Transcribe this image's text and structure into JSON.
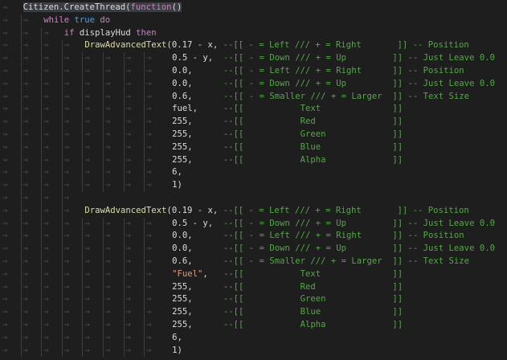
{
  "code": {
    "colors": {
      "background": "#1e1e1e",
      "text": "#dcdcdc",
      "keyword": "#c586c0",
      "boolean": "#569cd6",
      "function": "#dcdcaa",
      "string": "#d69d85",
      "comment": "#57a64a"
    },
    "lines": [
      {
        "indent": 1,
        "highlight": true,
        "tokens": [
          {
            "t": "tx",
            "text": "Citizen.CreateThread("
          },
          {
            "t": "kw",
            "text": "function"
          },
          {
            "t": "tx",
            "text": "()"
          }
        ]
      },
      {
        "indent": 2,
        "tokens": [
          {
            "t": "kw",
            "text": "while"
          },
          {
            "t": "tx",
            "text": " "
          },
          {
            "t": "bool",
            "text": "true"
          },
          {
            "t": "tx",
            "text": " "
          },
          {
            "t": "kw",
            "text": "do"
          }
        ]
      },
      {
        "indent": 3,
        "tokens": [
          {
            "t": "kw",
            "text": "if"
          },
          {
            "t": "tx",
            "text": " displayHud "
          },
          {
            "t": "kw",
            "text": "then"
          }
        ]
      },
      {
        "indent": 4,
        "tokens": [
          {
            "t": "fn",
            "text": "DrawAdvancedText"
          },
          {
            "t": "tx",
            "text": "(0.17 - x, "
          },
          {
            "t": "cm",
            "text": "--[[ - = Left /// + = Right       ]] -- Position"
          }
        ]
      },
      {
        "indent": 8,
        "tokens": [
          {
            "t": "tx",
            "text": " 0.5 - y,  "
          },
          {
            "t": "cm",
            "text": "--[[ - = Down /// + = Up         ]] -- Just Leave 0.0"
          }
        ]
      },
      {
        "indent": 8,
        "tokens": [
          {
            "t": "tx",
            "text": " 0.0,      "
          },
          {
            "t": "cm",
            "text": "--[[ - = Left /// + = Right      ]] -- Position"
          }
        ]
      },
      {
        "indent": 8,
        "tokens": [
          {
            "t": "tx",
            "text": " 0.0,      "
          },
          {
            "t": "cm",
            "text": "--[[ - = Down /// + = Up         ]] -- Just Leave 0.0"
          }
        ]
      },
      {
        "indent": 8,
        "tokens": [
          {
            "t": "tx",
            "text": " 0.6,      "
          },
          {
            "t": "cm",
            "text": "--[[ - = Smaller /// + = Larger  ]] -- Text Size"
          }
        ]
      },
      {
        "indent": 8,
        "tokens": [
          {
            "t": "tx",
            "text": " fuel,     "
          },
          {
            "t": "cm",
            "text": "--[[           Text              ]]"
          }
        ]
      },
      {
        "indent": 8,
        "tokens": [
          {
            "t": "tx",
            "text": " 255,      "
          },
          {
            "t": "cm",
            "text": "--[[           Red               ]]"
          }
        ]
      },
      {
        "indent": 8,
        "tokens": [
          {
            "t": "tx",
            "text": " 255,      "
          },
          {
            "t": "cm",
            "text": "--[[           Green             ]]"
          }
        ]
      },
      {
        "indent": 8,
        "tokens": [
          {
            "t": "tx",
            "text": " 255,      "
          },
          {
            "t": "cm",
            "text": "--[[           Blue              ]]"
          }
        ]
      },
      {
        "indent": 8,
        "tokens": [
          {
            "t": "tx",
            "text": " 255,      "
          },
          {
            "t": "cm",
            "text": "--[[           Alpha             ]]"
          }
        ]
      },
      {
        "indent": 8,
        "tokens": [
          {
            "t": "tx",
            "text": " 6,"
          }
        ]
      },
      {
        "indent": 8,
        "tokens": [
          {
            "t": "tx",
            "text": " 1)"
          }
        ]
      },
      {
        "indent": 4,
        "tokens": []
      },
      {
        "indent": 4,
        "tokens": [
          {
            "t": "fn",
            "text": "DrawAdvancedText"
          },
          {
            "t": "tx",
            "text": "(0.19 - x, "
          },
          {
            "t": "cm",
            "text": "--[[ - = Left /// + = Right       ]] -- Position"
          }
        ]
      },
      {
        "indent": 8,
        "tokens": [
          {
            "t": "tx",
            "text": " 0.5 - y,  "
          },
          {
            "t": "cm",
            "text": "--[[ - = Down /// + = Up         ]] -- Just Leave 0.0"
          }
        ]
      },
      {
        "indent": 8,
        "tokens": [
          {
            "t": "tx",
            "text": " 0.0,      "
          },
          {
            "t": "cm",
            "text": "--[[ - = Left /// + = Right      ]] -- Position"
          }
        ]
      },
      {
        "indent": 8,
        "tokens": [
          {
            "t": "tx",
            "text": " 0.0,      "
          },
          {
            "t": "cm",
            "text": "--[[ - = Down /// + = Up         ]] -- Just Leave 0.0"
          }
        ]
      },
      {
        "indent": 8,
        "tokens": [
          {
            "t": "tx",
            "text": " 0.6,      "
          },
          {
            "t": "cm",
            "text": "--[[ - = Smaller /// + = Larger  ]] -- Text Size"
          }
        ]
      },
      {
        "indent": 8,
        "tokens": [
          {
            "t": "tx",
            "text": " "
          },
          {
            "t": "str",
            "text": "\"Fuel\""
          },
          {
            "t": "tx",
            "text": ",   "
          },
          {
            "t": "cm",
            "text": "--[[           Text              ]]"
          }
        ]
      },
      {
        "indent": 8,
        "tokens": [
          {
            "t": "tx",
            "text": " 255,      "
          },
          {
            "t": "cm",
            "text": "--[[           Red               ]]"
          }
        ]
      },
      {
        "indent": 8,
        "tokens": [
          {
            "t": "tx",
            "text": " 255,      "
          },
          {
            "t": "cm",
            "text": "--[[           Green             ]]"
          }
        ]
      },
      {
        "indent": 8,
        "tokens": [
          {
            "t": "tx",
            "text": " 255,      "
          },
          {
            "t": "cm",
            "text": "--[[           Blue              ]]"
          }
        ]
      },
      {
        "indent": 8,
        "tokens": [
          {
            "t": "tx",
            "text": " 255,      "
          },
          {
            "t": "cm",
            "text": "--[[           Alpha             ]]"
          }
        ]
      },
      {
        "indent": 8,
        "tokens": [
          {
            "t": "tx",
            "text": " 6,"
          }
        ]
      },
      {
        "indent": 8,
        "tokens": [
          {
            "t": "tx",
            "text": " 1)"
          }
        ]
      }
    ]
  }
}
